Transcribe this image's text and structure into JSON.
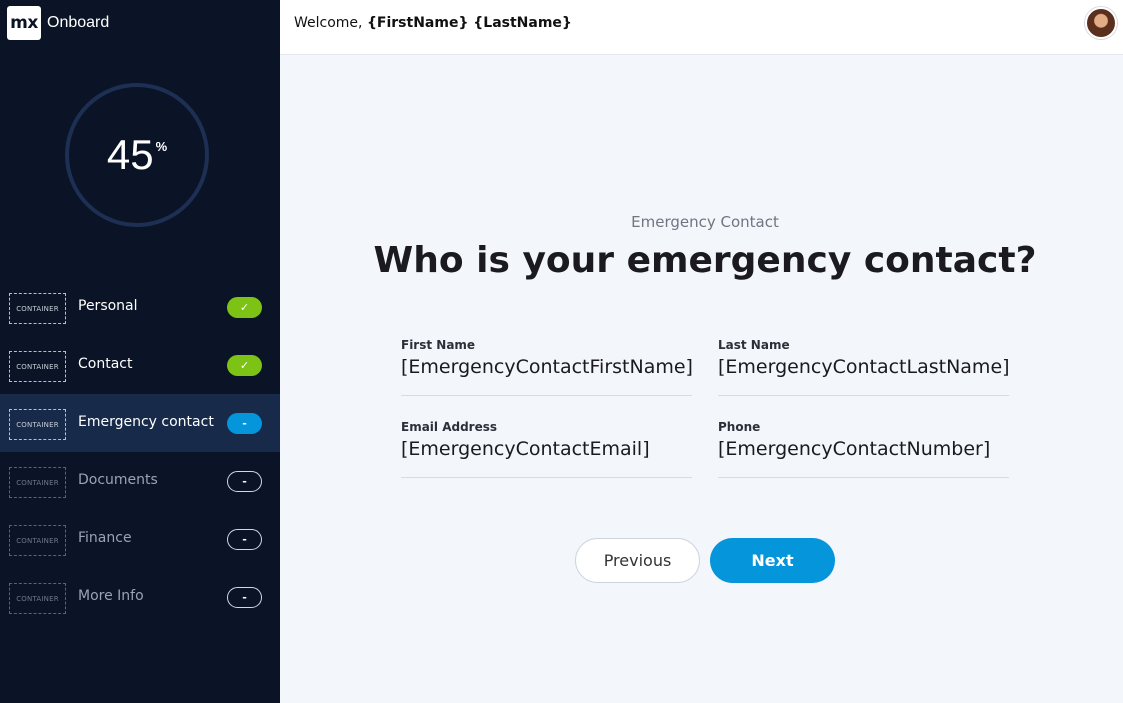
{
  "app": {
    "logo_text": "mx",
    "name": "Onboard"
  },
  "progress": {
    "value": "45",
    "unit": "%",
    "fraction": 0.45
  },
  "steps": [
    {
      "container_label": "CONTAINER",
      "label": "Personal",
      "status": "done",
      "badge": "✓"
    },
    {
      "container_label": "CONTAINER",
      "label": "Contact",
      "status": "done",
      "badge": "✓"
    },
    {
      "container_label": "CONTAINER",
      "label": "Emergency contact",
      "status": "current",
      "badge": "-"
    },
    {
      "container_label": "CONTAINER",
      "label": "Documents",
      "status": "todo",
      "badge": "-"
    },
    {
      "container_label": "CONTAINER",
      "label": "Finance",
      "status": "todo",
      "badge": "-"
    },
    {
      "container_label": "CONTAINER",
      "label": "More Info",
      "status": "todo",
      "badge": "-"
    }
  ],
  "header": {
    "welcome_prefix": "Welcome, ",
    "user_name": "{FirstName} {LastName}"
  },
  "page": {
    "eyebrow": "Emergency Contact",
    "title": "Who is your emergency contact?"
  },
  "form": {
    "first_name": {
      "label": "First Name",
      "value": "[EmergencyContactFirstName]"
    },
    "last_name": {
      "label": "Last Name",
      "value": "[EmergencyContactLastName]"
    },
    "email": {
      "label": "Email Address",
      "value": "[EmergencyContactEmail]"
    },
    "phone": {
      "label": "Phone",
      "value": "[EmergencyContactNumber]"
    }
  },
  "actions": {
    "previous_label": "Previous",
    "next_label": "Next"
  },
  "colors": {
    "sidebar_bg": "#0b1426",
    "active_step_bg": "#172a4a",
    "done_badge": "#7cc316",
    "accent": "#0595db"
  }
}
